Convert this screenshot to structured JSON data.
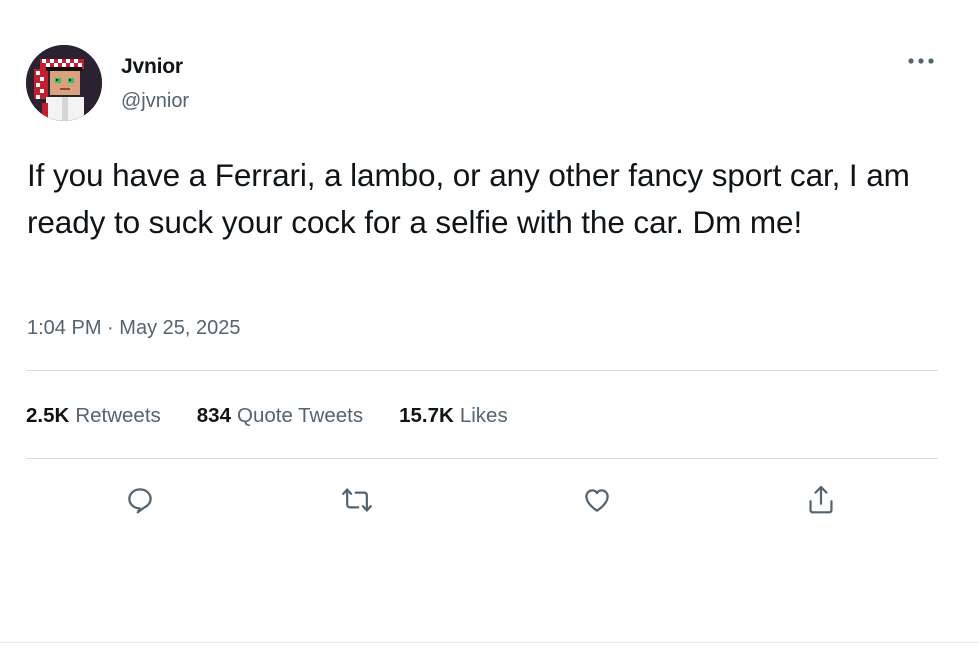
{
  "author": {
    "display_name": "Jvnior",
    "handle": "@jvnior",
    "avatar_icon": "pixel-art-avatar"
  },
  "tweet": {
    "text": "If you have a Ferrari, a lambo, or any other fancy sport car, I am ready to suck your cock for a selfie with the car. Dm me!",
    "time": "1:04 PM",
    "separator": "·",
    "date": "May 25, 2025"
  },
  "stats": {
    "retweets_count": "2.5K",
    "retweets_label": "Retweets",
    "quotes_count": "834",
    "quotes_label": "Quote Tweets",
    "likes_count": "15.7K",
    "likes_label": "Likes"
  },
  "actions": {
    "reply_icon": "reply-icon",
    "retweet_icon": "retweet-icon",
    "like_icon": "heart-icon",
    "share_icon": "share-icon",
    "more_icon": "more-dots-icon"
  },
  "colors": {
    "text_primary": "#0f1419",
    "text_secondary": "#536471",
    "divider": "#d7dce0"
  }
}
